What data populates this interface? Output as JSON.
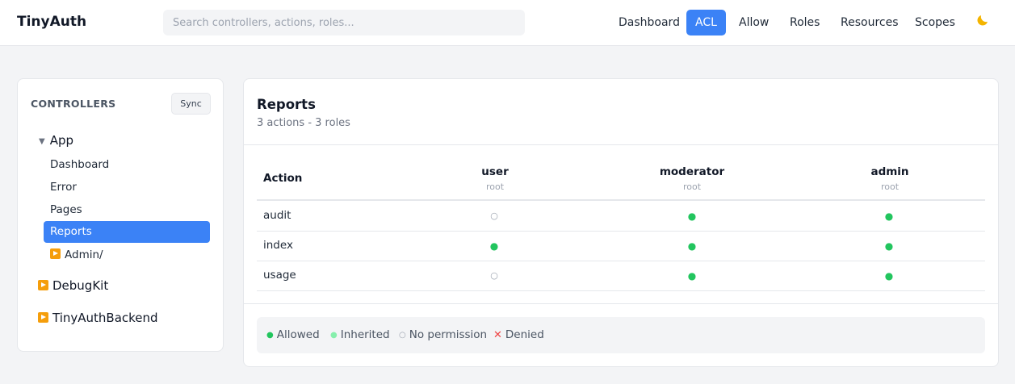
{
  "app": {
    "title": "TinyAuth"
  },
  "search": {
    "placeholder": "Search controllers, actions, roles..."
  },
  "nav": {
    "items": [
      {
        "label": "Dashboard",
        "active": false
      },
      {
        "label": "ACL",
        "active": true
      },
      {
        "label": "Allow",
        "active": false
      },
      {
        "label": "Roles",
        "active": false
      },
      {
        "label": "Resources",
        "active": false
      },
      {
        "label": "Scopes",
        "active": false
      }
    ],
    "theme_icon": "moon-icon"
  },
  "sidebar": {
    "title": "CONTROLLERS",
    "sync_label": "Sync",
    "tree": {
      "app": {
        "label": "App",
        "expanded": true
      },
      "children": [
        "Dashboard",
        "Error",
        "Pages",
        "Reports",
        "Admin/"
      ],
      "selected": "Reports",
      "plugins": [
        "DebugKit",
        "TinyAuthBackend"
      ]
    }
  },
  "main": {
    "title": "Reports",
    "subtitle": "3 actions - 3 roles",
    "table": {
      "action_header": "Action",
      "roles": [
        {
          "name": "user",
          "sub": "root"
        },
        {
          "name": "moderator",
          "sub": "root"
        },
        {
          "name": "admin",
          "sub": "root"
        }
      ],
      "rows": [
        {
          "action": "audit",
          "cells": [
            "none",
            "allowed",
            "allowed"
          ]
        },
        {
          "action": "index",
          "cells": [
            "allowed",
            "allowed",
            "allowed"
          ]
        },
        {
          "action": "usage",
          "cells": [
            "none",
            "allowed",
            "allowed"
          ]
        }
      ]
    },
    "legend": {
      "allowed": "Allowed",
      "inherited": "Inherited",
      "none": "No permission",
      "denied": "Denied"
    }
  },
  "colors": {
    "accent": "#3b82f6",
    "allowed": "#22c55e",
    "inherited": "#86efac",
    "none": "#9ca3af",
    "denied": "#ef4444"
  }
}
